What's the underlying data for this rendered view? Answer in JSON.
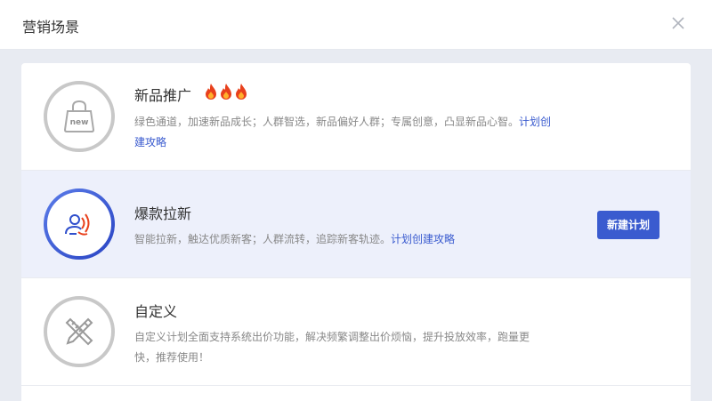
{
  "modal": {
    "title": "营销场景"
  },
  "scenes": [
    {
      "name": "新品推广",
      "desc": "绿色通道，加速新品成长；人群智选，新品偏好人群；专属创意，凸显新品心智。",
      "link": "计划创建攻略",
      "icon": "new-bag-icon"
    },
    {
      "name": "爆款拉新",
      "desc": "智能拉新，触达优质新客；人群流转，追踪新客轨迹。",
      "link": "计划创建攻略",
      "button": "新建计划",
      "icon": "user-signal-icon"
    },
    {
      "name": "自定义",
      "desc": "自定义计划全面支持系统出价功能，解决频繁调整出价烦恼，提升投放效率，跑量更快，推荐使用！",
      "icon": "pencil-ruler-icon"
    }
  ],
  "colors": {
    "accent": "#3a5bcf",
    "fire": "#e8401c",
    "active_bg": "#edf0fb"
  }
}
